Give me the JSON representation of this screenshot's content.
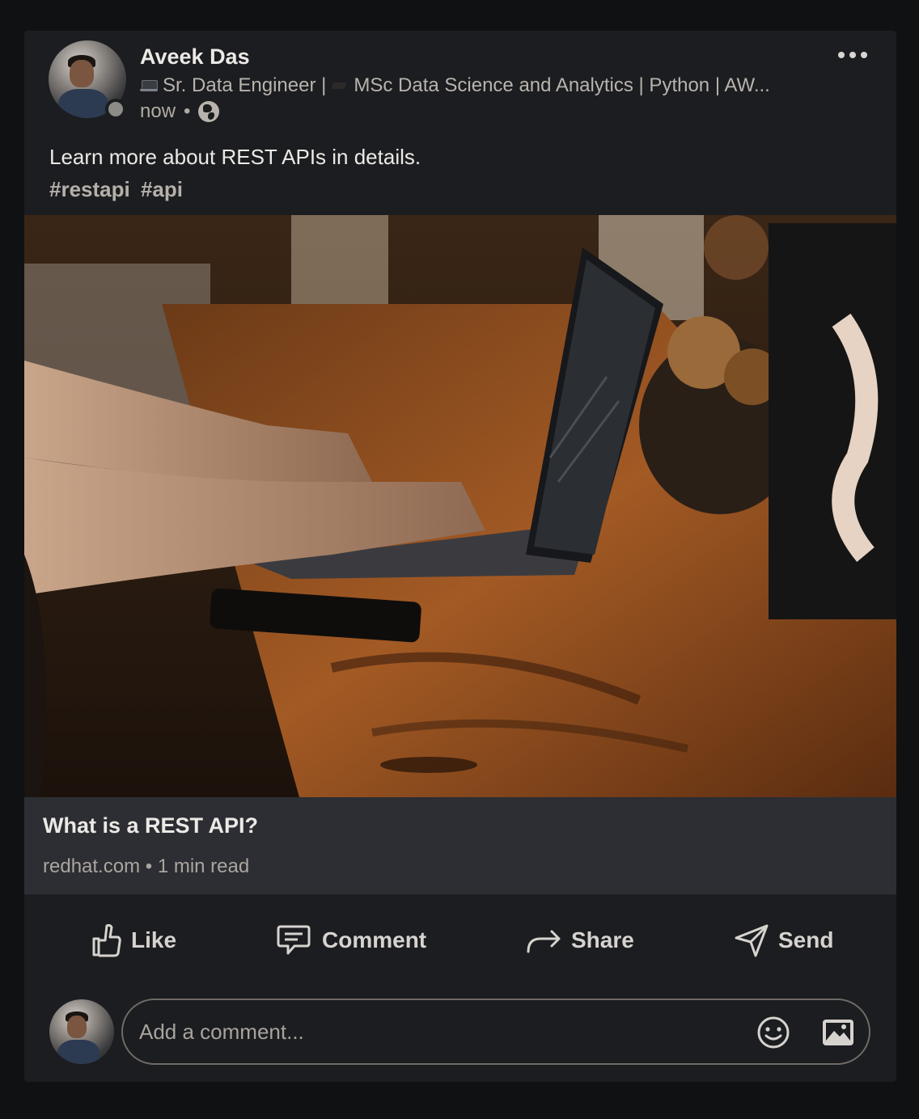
{
  "post": {
    "author": {
      "name": "Aveek Das",
      "headline": "Sr. Data Engineer | 🎓 MSc Data Science and Analytics | Python | AW...",
      "headline_parts": [
        "Sr. Data Engineer |",
        "MSc Data Science and Analytics | Python | AW..."
      ],
      "time": "now",
      "separator": "•",
      "visibility_icon": "globe-icon"
    },
    "more_icon": "more-horizontal-icon",
    "text": "Learn more about REST APIs in details.",
    "hashtags": [
      "#restapi",
      "#api"
    ]
  },
  "article": {
    "image_description_icon": "laptop-photo",
    "title": "What is a REST API?",
    "source": "redhat.com",
    "separator": "•",
    "read_time": "1 min read"
  },
  "actions": {
    "like": "Like",
    "comment": "Comment",
    "share": "Share",
    "send": "Send"
  },
  "comment_bar": {
    "placeholder": "Add a comment...",
    "emoji_icon": "emoji-icon",
    "image_icon": "image-icon"
  },
  "colors": {
    "background": "#101112",
    "card": "#1b1d20",
    "article_footer": "#2c2e33",
    "text_primary": "#ece9e6",
    "text_secondary": "#b8b3ad"
  }
}
